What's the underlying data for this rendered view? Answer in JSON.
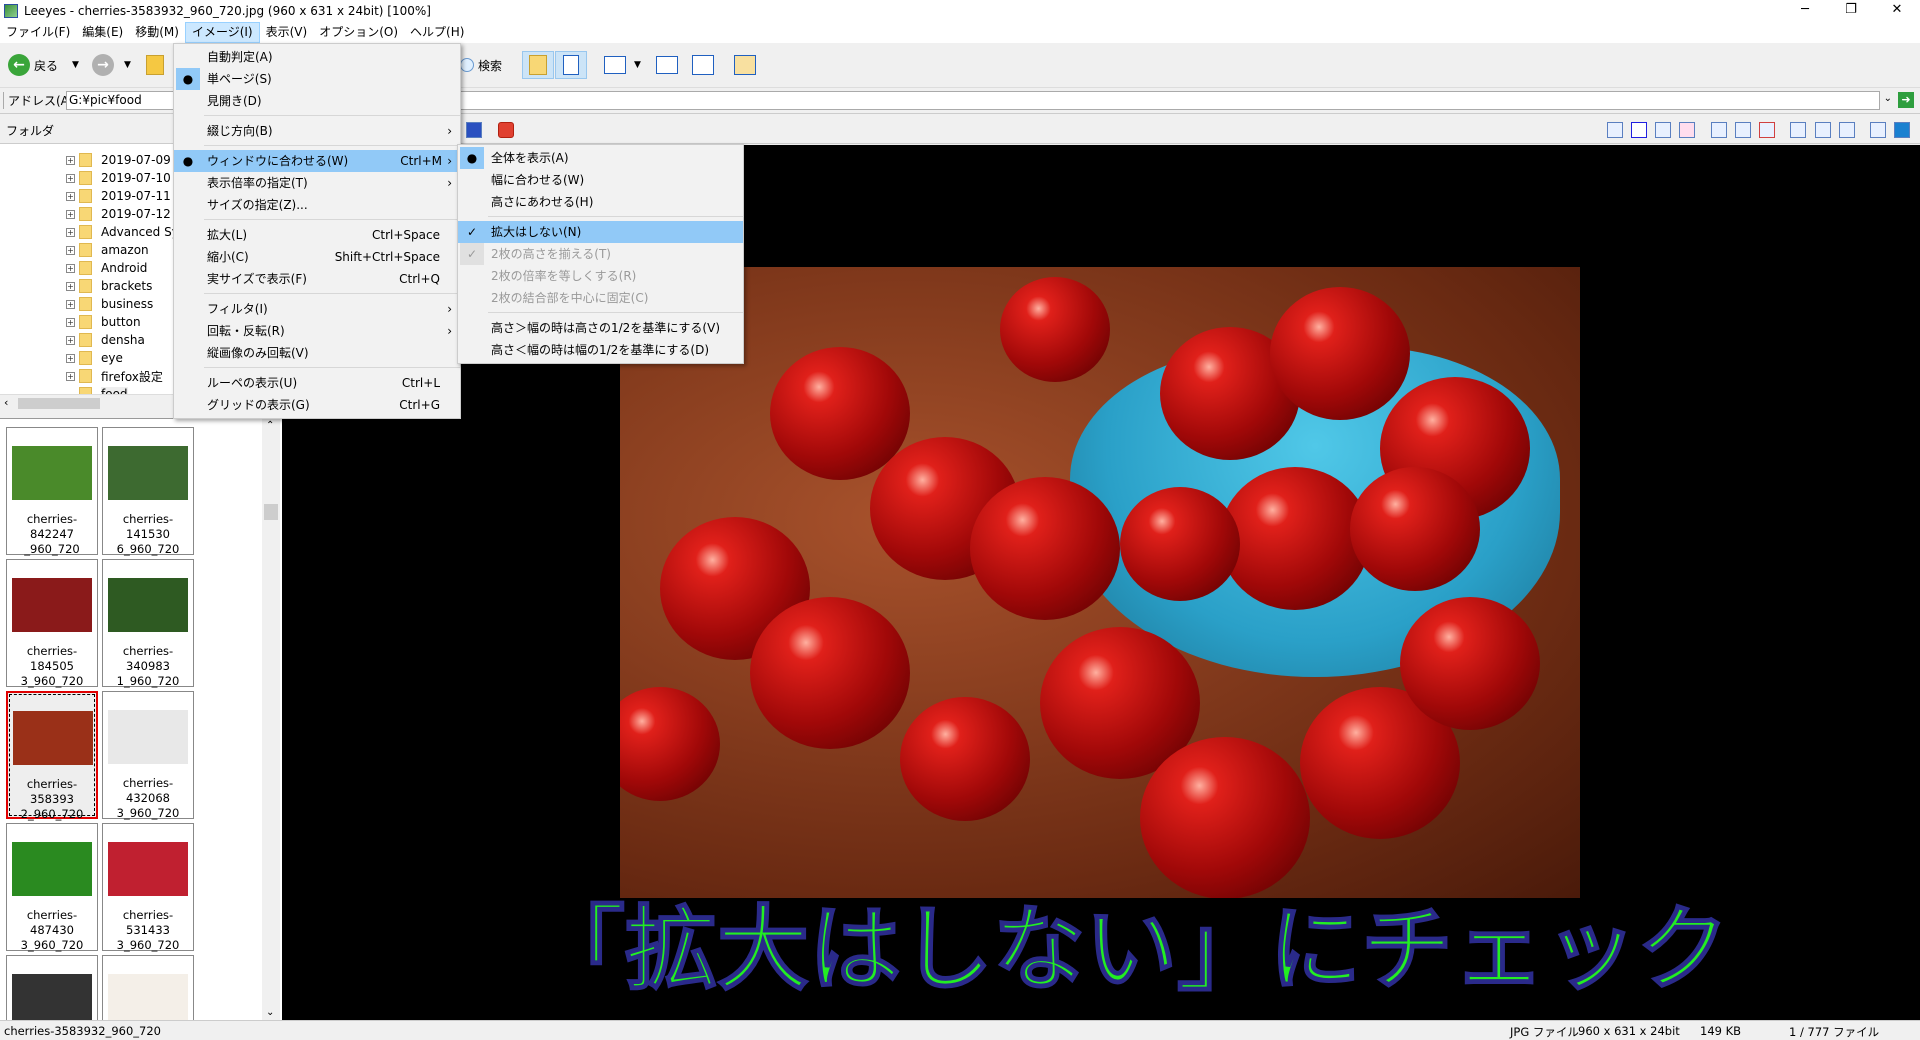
{
  "window": {
    "title": "Leeyes - cherries-3583932_960_720.jpg (960 x 631 x 24bit) [100%]",
    "minimize": "─",
    "maximize": "❐",
    "close": "✕"
  },
  "menubar": [
    "ファイル(F)",
    "編集(E)",
    "移動(M)",
    "イメージ(I)",
    "表示(V)",
    "オプション(O)",
    "ヘルプ(H)"
  ],
  "toolbar": {
    "back": "戻る",
    "search": "検索"
  },
  "address": {
    "label": "アドレス(A)",
    "value": "G:¥pic¥food"
  },
  "folder_panel": {
    "label": "フォルダ"
  },
  "tree": [
    "2019-07-09",
    "2019-07-10",
    "2019-07-11",
    "2019-07-12",
    "Advanced Sy",
    "amazon",
    "Android",
    "brackets",
    "business",
    "button",
    "densha",
    "eye",
    "firefox設定",
    "food"
  ],
  "thumbnails": [
    {
      "name": "cherries-842247\n_960_720",
      "l1": "cherries-842247",
      "l2": "_960_720",
      "color": "#4a8a2a"
    },
    {
      "name": "cherries-1415306_960_720",
      "l1": "cherries-141530",
      "l2": "6_960_720",
      "color": "#3d6a30"
    },
    {
      "name": "cherries-1845053_960_720",
      "l1": "cherries-184505",
      "l2": "3_960_720",
      "color": "#8a1a1a"
    },
    {
      "name": "cherries-3409831_960_720",
      "l1": "cherries-340983",
      "l2": "1_960_720",
      "color": "#2e5a22"
    },
    {
      "name": "cherries-3583932_960_720",
      "l1": "cherries-358393",
      "l2": "2_960_720",
      "color": "#9a3018",
      "selected": true
    },
    {
      "name": "cherries-4320683_960_720",
      "l1": "cherries-432068",
      "l2": "3_960_720",
      "color": "#e8e8e8"
    },
    {
      "name": "cherries-4874303_960_720",
      "l1": "cherries-487430",
      "l2": "3_960_720",
      "color": "#2a8a20"
    },
    {
      "name": "cherries-5314333_960_720",
      "l1": "cherries-531433",
      "l2": "3_960_720",
      "color": "#c02030"
    },
    {
      "name": "",
      "l1": "",
      "l2": "",
      "color": "#333333"
    },
    {
      "name": "",
      "l1": "",
      "l2": "",
      "color": "#f4efe8"
    }
  ],
  "image_menu": [
    {
      "label": "自動判定(A)"
    },
    {
      "label": "単ページ(S)",
      "mark": "●",
      "markbg": true
    },
    {
      "label": "見開き(D)"
    },
    {
      "sep": true
    },
    {
      "label": "綴じ方向(B)",
      "arrow": "›"
    },
    {
      "sep": true
    },
    {
      "label": "ウィンドウに合わせる(W)",
      "shortcut": "Ctrl+M",
      "arrow": "›",
      "mark": "●",
      "highlight": true
    },
    {
      "label": "表示倍率の指定(T)",
      "arrow": "›"
    },
    {
      "label": "サイズの指定(Z)..."
    },
    {
      "sep": true
    },
    {
      "label": "拡大(L)",
      "shortcut": "Ctrl+Space"
    },
    {
      "label": "縮小(C)",
      "shortcut": "Shift+Ctrl+Space"
    },
    {
      "label": "実サイズで表示(F)",
      "shortcut": "Ctrl+Q"
    },
    {
      "sep": true
    },
    {
      "label": "フィルタ(I)",
      "arrow": "›"
    },
    {
      "label": "回転・反転(R)",
      "arrow": "›"
    },
    {
      "label": "縦画像のみ回転(V)"
    },
    {
      "sep": true
    },
    {
      "label": "ルーペの表示(U)",
      "shortcut": "Ctrl+L"
    },
    {
      "label": "グリッドの表示(G)",
      "shortcut": "Ctrl+G"
    }
  ],
  "fit_submenu": [
    {
      "label": "全体を表示(A)",
      "mark": "●",
      "markbg": true
    },
    {
      "label": "幅に合わせる(W)"
    },
    {
      "label": "高さにあわせる(H)"
    },
    {
      "sep": true
    },
    {
      "label": "拡大はしない(N)",
      "mark": "✓",
      "highlight": true,
      "checked": true
    },
    {
      "label": "2枚の高さを揃える(T)",
      "mark": "✓",
      "disabled": true,
      "markbg": true
    },
    {
      "label": "2枚の倍率を等しくする(R)",
      "disabled": true
    },
    {
      "label": "2枚の結合部を中心に固定(C)",
      "disabled": true
    },
    {
      "sep": true
    },
    {
      "label": "高さ＞幅の時は高さの1/2を基準にする(V)"
    },
    {
      "label": "高さ＜幅の時は幅の1/2を基準にする(D)"
    }
  ],
  "caption": "「拡大はしない」にチェック",
  "statusbar": {
    "filename": "cherries-3583932_960_720",
    "type": "JPG ファイル",
    "dimensions": "960 x 631 x 24bit",
    "size": "149 KB",
    "count": "1 / 777 ファイル"
  },
  "colors": {
    "menu_highlight": "#91c9f7",
    "caption": "#22ee22",
    "selection_border": "#e00000"
  }
}
